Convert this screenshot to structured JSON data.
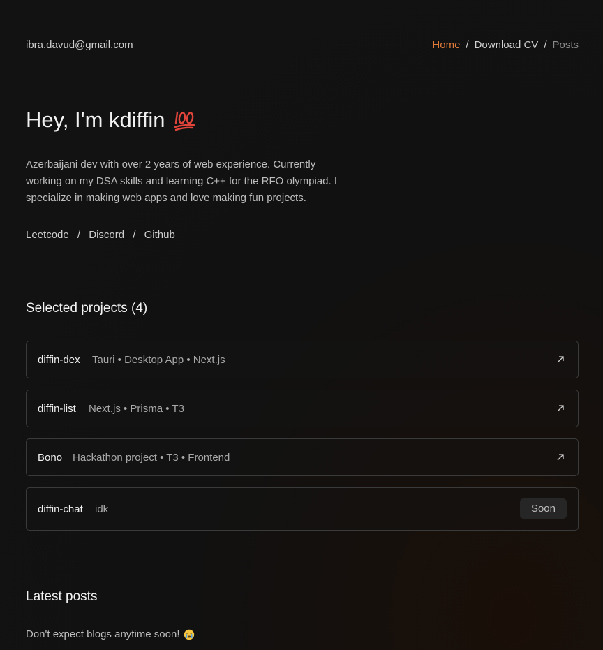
{
  "header": {
    "email": "ibra.davud@gmail.com",
    "nav": [
      {
        "label": "Home",
        "state": "active"
      },
      {
        "label": "Download CV",
        "state": "normal"
      },
      {
        "label": "Posts",
        "state": "muted"
      }
    ],
    "separator": "/"
  },
  "hero": {
    "title": "Hey, I'm kdiffin",
    "title_emoji": "hundred-points-icon",
    "bio": "Azerbaijani dev with over 2 years of web experience. Currently working on my DSA skills and learning C++ for the RFO olympiad. I specialize in making web apps and love making fun projects."
  },
  "social_links": [
    "Leetcode",
    "Discord",
    "Github"
  ],
  "projects_section": {
    "title": "Selected projects (4)",
    "items": [
      {
        "name": "diffin-dex",
        "tags": "Tauri • Desktop App • Next.js",
        "action": "external-link-icon"
      },
      {
        "name": "diffin-list",
        "tags": "Next.js • Prisma • T3",
        "action": "external-link-icon"
      },
      {
        "name": "Bono",
        "tags": "Hackathon project • T3 • Frontend",
        "action": "external-link-icon"
      },
      {
        "name": "diffin-chat",
        "tags": "idk",
        "badge": "Soon"
      }
    ]
  },
  "posts_section": {
    "title": "Latest posts",
    "text": "Don't expect blogs anytime soon!",
    "text_emoji": "crying-face-icon"
  },
  "colors": {
    "background": "#111111",
    "accent": "#e07b39",
    "border": "#3a3a3a"
  }
}
